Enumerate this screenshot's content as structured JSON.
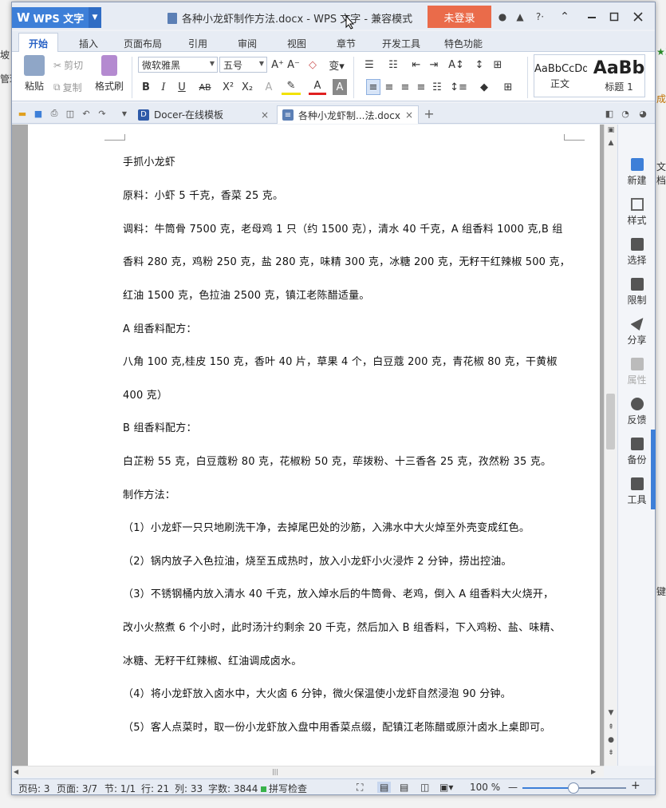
{
  "window": {
    "app_button": "WPS 文字",
    "title": "各种小龙虾制作方法.docx - WPS 文字 - 兼容模式",
    "login_button": "未登录",
    "title_icons": {
      "skin": "●",
      "shirt": "▲",
      "help": "?·",
      "restore": "⌃"
    }
  },
  "menu": {
    "tabs": [
      "开始",
      "插入",
      "页面布局",
      "引用",
      "审阅",
      "视图",
      "章节",
      "开发工具",
      "特色功能"
    ]
  },
  "ribbon": {
    "paste": "粘贴",
    "cut": "剪切",
    "copy": "复制",
    "format_painter": "格式刷",
    "font_name": "微软雅黑",
    "font_size": "五号",
    "bold": "B",
    "italic": "I",
    "underline": "U",
    "strike": "AB",
    "superscript": "X²",
    "subscript": "X₂",
    "styles": [
      {
        "sample": "AaBbCcDd",
        "caption": "正文"
      },
      {
        "sample": "AaBb",
        "caption": "标题 1"
      }
    ]
  },
  "doc_tabs": [
    {
      "label": "Docer-在线模板",
      "close": "×"
    },
    {
      "label": "各种小龙虾制...法.docx",
      "close": "×"
    }
  ],
  "new_tab": "+",
  "document": {
    "lines": [
      "手抓小龙虾",
      "原料：小虾 5 千克，香菜 25 克。",
      "调料：牛筒骨 7500 克，老母鸡 1 只（约 1500 克），清水 40 千克，A 组香料 1000 克,B 组",
      "香料 280 克，鸡粉 250 克，盐 280 克，味精 300 克，冰糖 200 克，无籽干红辣椒 500 克，",
      "红油 1500 克，色拉油 2500 克，镇江老陈醋适量。",
      "A 组香料配方：",
      "八角 100 克,桂皮 150 克，香叶 40 片，草果 4 个，白豆蔻 200 克，青花椒 80 克，干黄椒",
      "400 克）",
      "B 组香料配方：",
      "白芷粉 55 克，白豆蔻粉 80 克，花椒粉 50 克，荜拨粉、十三香各 25 克，孜然粉 35 克。",
      "制作方法：",
      "（1）小龙虾一只只地刷洗干净，去掉尾巴处的沙筋，入沸水中大火焯至外壳变成红色。",
      "（2）锅内放子入色拉油，烧至五成热时，放入小龙虾小火浸炸 2 分钟，捞出控油。",
      "（3）不锈钢桶内放入清水 40 千克，放入焯水后的牛筒骨、老鸡，倒入 A 组香料大火烧开，",
      "改小火熬煮 6 个小时，此时汤汁约剩余 20 千克，然后加入 B 组香料，下入鸡粉、盐、味精、",
      "冰糖、无籽干红辣椒、红油调成卤水。",
      "（4）将小龙虾放入卤水中，大火卤 6 分钟，微火保温使小龙虾自然浸泡 90 分钟。",
      "（5）客人点菜时，取一份小龙虾放入盘中用香菜点缀，配镇江老陈醋或原汁卤水上桌即可。"
    ]
  },
  "task_pane": [
    "新建",
    "样式",
    "选择",
    "限制",
    "分享",
    "属性",
    "反馈",
    "备份",
    "工具"
  ],
  "status": {
    "page_code": "页码: 3",
    "pages": "页面: 3/7",
    "section": "节: 1/1",
    "row": "行: 21",
    "col": "列: 33",
    "words": "字数: 3844",
    "spell": "拼写检查",
    "zoom": "100 %"
  },
  "background": {
    "left_frags": [
      "坡",
      "管理"
    ],
    "right_frags": [
      "★3",
      "成",
      "文档",
      "键"
    ]
  },
  "colors": {
    "accent": "#3d7fd8",
    "login": "#ea6b4a"
  }
}
